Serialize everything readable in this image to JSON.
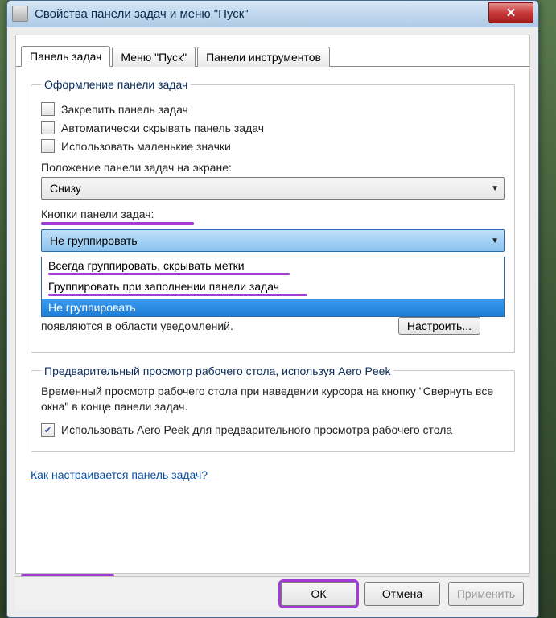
{
  "window": {
    "title": "Свойства панели задач и меню \"Пуск\""
  },
  "tabs": {
    "taskbar": "Панель задач",
    "startmenu": "Меню \"Пуск\"",
    "toolbars": "Панели инструментов"
  },
  "group_design": {
    "legend": "Оформление панели задач",
    "lock": "Закрепить панель задач",
    "autohide": "Автоматически скрывать панель задач",
    "smallicons": "Использовать маленькие значки",
    "position_label": "Положение панели задач на экране:",
    "position_value": "Снизу",
    "buttons_label": "Кнопки панели задач:",
    "buttons_value": "Не группировать",
    "buttons_options": {
      "opt0": "Всегда группировать, скрывать метки",
      "opt1": "Группировать при заполнении панели задач",
      "opt2": "Не группировать"
    }
  },
  "notify_area": {
    "text": "появляются в области уведомлений.",
    "button": "Настроить..."
  },
  "group_aero": {
    "legend": "Предварительный просмотр рабочего стола, используя Aero Peek",
    "desc": "Временный просмотр рабочего стола при наведении курсора на кнопку \"Свернуть все окна\" в конце панели задач.",
    "use_aero": "Использовать Aero Peek для предварительного просмотра рабочего стола"
  },
  "help_link": "Как настраивается панель задач?",
  "buttons": {
    "ok": "ОК",
    "cancel": "Отмена",
    "apply": "Применить"
  }
}
